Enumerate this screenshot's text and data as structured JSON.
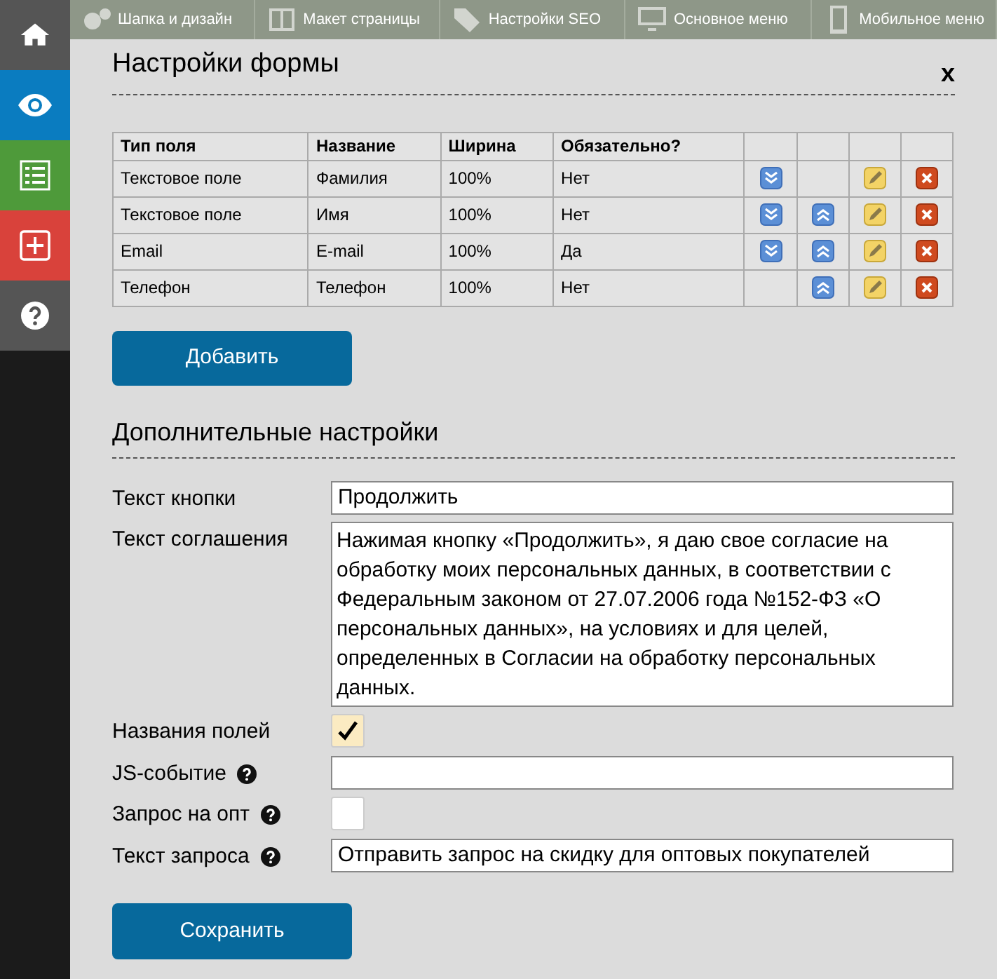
{
  "sidebar": {
    "items": [
      {
        "color": "#555555"
      },
      {
        "color": "#0a7cc0"
      },
      {
        "color": "#4e9a3a"
      },
      {
        "color": "#d9423b"
      },
      {
        "color": "#555555"
      }
    ]
  },
  "top_tabs": [
    {
      "label": "Шапка и дизайн"
    },
    {
      "label": "Макет страницы"
    },
    {
      "label": "Настройки SEO"
    },
    {
      "label": "Основное меню"
    },
    {
      "label": "Мобильное меню"
    }
  ],
  "dialog": {
    "title": "Настройки формы",
    "close": "x",
    "table": {
      "columns": [
        "Тип поля",
        "Название",
        "Ширина",
        "Обязательно?"
      ],
      "rows": [
        {
          "cells": [
            "Текстовое поле",
            "Фамилия",
            "100%",
            "Нет"
          ],
          "move_down": true,
          "move_up": false
        },
        {
          "cells": [
            "Текстовое поле",
            "Имя",
            "100%",
            "Нет"
          ],
          "move_down": true,
          "move_up": true
        },
        {
          "cells": [
            "Email",
            "E-mail",
            "100%",
            "Да"
          ],
          "move_down": true,
          "move_up": true
        },
        {
          "cells": [
            "Телефон",
            "Телефон",
            "100%",
            "Нет"
          ],
          "move_down": false,
          "move_up": true
        }
      ]
    },
    "add_button": "Добавить",
    "section_title": "Дополнительные настройки",
    "fields": [
      {
        "kind": "text",
        "label": "Текст кнопки",
        "help": false,
        "value": "Продолжить"
      },
      {
        "kind": "textarea",
        "label": "Текст соглашения",
        "help": false,
        "value": "Нажимая кнопку «Продолжить», я даю свое согласие на обработку моих персональных данных, в соответствии с Федеральным законом от 27.07.2006 года №152-ФЗ «О персональных данных», на условиях и для целей, определенных в Согласии на обработку персональных данных."
      },
      {
        "kind": "checkbox",
        "label": "Названия полей",
        "help": false,
        "checked": true
      },
      {
        "kind": "text",
        "label": "JS-событие",
        "help": true
      },
      {
        "kind": "checkbox",
        "label": "Запрос на опт",
        "help": true,
        "checked": false
      },
      {
        "kind": "text",
        "label": "Текст запроса",
        "help": true,
        "value": "Отправить запрос на скидку для оптовых покупателей"
      }
    ],
    "save_button": "Сохранить"
  }
}
